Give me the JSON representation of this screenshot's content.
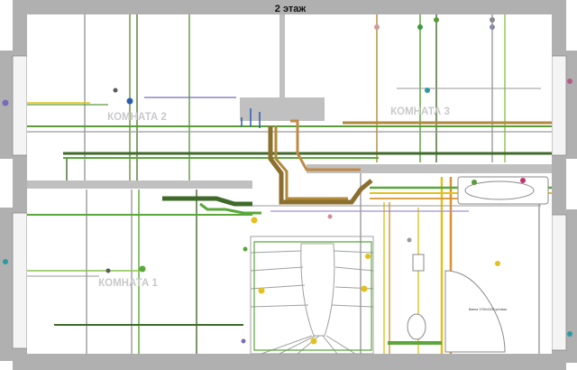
{
  "plan": {
    "title": "2 этаж",
    "rooms": [
      {
        "id": "room2",
        "label": "КОМНАТА 2"
      },
      {
        "id": "room3",
        "label": "КОМНАТА 3"
      },
      {
        "id": "room1",
        "label": "КОМНАТА 1"
      }
    ],
    "fixture_note": "Ванна 1700х1200 угловая"
  },
  "colors": {
    "wall": "#a9a9a9",
    "floor_line": "#d8d8d8",
    "green_dark": "#3f6a2a",
    "green": "#5aa73a",
    "green_light": "#8ac44b",
    "lime": "#b7d45a",
    "yellow": "#e2c11f",
    "orange": "#d9922f",
    "brown": "#9a7a3b",
    "purple": "#7a6bb8",
    "blue": "#2a5db0",
    "teal": "#2b9aa3",
    "pink": "#c06a8a",
    "gray_line": "#9b9b9b"
  }
}
